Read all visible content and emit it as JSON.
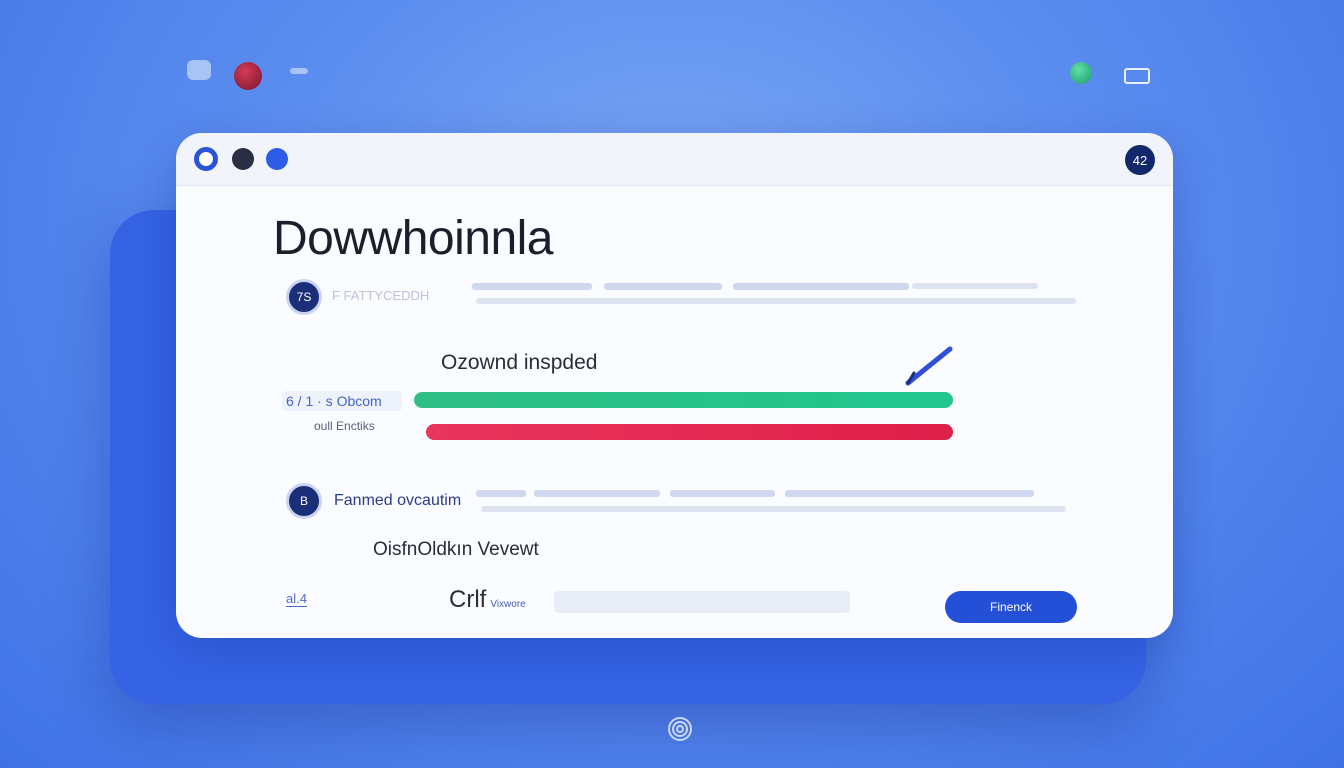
{
  "colors": {
    "background": "#5d8ff0",
    "window": "#fbfcff",
    "accent": "#2450d8",
    "progress_green": "#21c78f",
    "progress_red": "#df1f4a"
  },
  "window": {
    "badge": "42",
    "title": "Dowwhoinnla"
  },
  "file_row": {
    "icon_text": "7S",
    "label": "F   FATTYCEDDH"
  },
  "download": {
    "title": "Ozownd inspded",
    "speed_label": "6 / 1 · s  Obcom",
    "speed_sub": "oull Enctiks",
    "progress_green": 1.0,
    "progress_red": 1.0
  },
  "format_row": {
    "icon_text": "B",
    "label": "Fanmed  ovcautim"
  },
  "open_label": "OisfnOldkın Vevewt",
  "footer": {
    "left_link": "al.4",
    "mid_label": "Crlf",
    "mid_small": "Vixwore",
    "finish_button": "Finenck"
  },
  "icons": {
    "pen": "pen-icon",
    "fingerprint": "fingerprint-icon"
  }
}
